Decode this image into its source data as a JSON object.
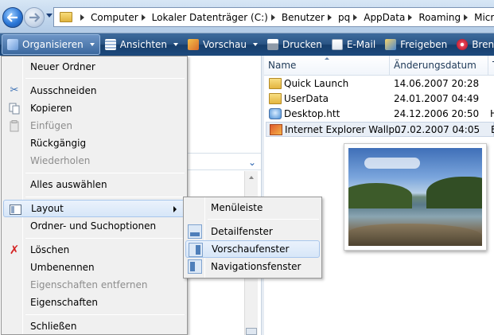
{
  "address": {
    "crumbs": [
      "Computer",
      "Lokaler Datenträger (C:)",
      "Benutzer",
      "pq",
      "AppData",
      "Roaming",
      "Microsoft"
    ]
  },
  "toolbar": {
    "organize": "Organisieren",
    "views": "Ansichten",
    "preview": "Vorschau",
    "print": "Drucken",
    "email": "E-Mail",
    "share": "Freigeben",
    "burn": "Brennen"
  },
  "columns": {
    "name": "Name",
    "date": "Änderungsdatum",
    "type": "T"
  },
  "files": [
    {
      "name": "Quick Launch",
      "date": "14.06.2007 20:28",
      "icon": "folder-icon",
      "tail": ""
    },
    {
      "name": "UserData",
      "date": "24.01.2007 04:49",
      "icon": "folder-icon",
      "tail": ""
    },
    {
      "name": "Desktop.htt",
      "date": "24.12.2006 20:50",
      "icon": "htt-file-icon",
      "tail": "H"
    },
    {
      "name": "Internet Explorer Wallp...",
      "date": "07.02.2007 04:05",
      "icon": "image-file-icon",
      "tail": "B"
    }
  ],
  "menu": {
    "new_folder": "Neuer Ordner",
    "cut": "Ausschneiden",
    "copy": "Kopieren",
    "paste": "Einfügen",
    "undo": "Rückgängig",
    "redo": "Wiederholen",
    "select_all": "Alles auswählen",
    "layout": "Layout",
    "folder_options": "Ordner- und Suchoptionen",
    "delete": "Löschen",
    "rename": "Umbenennen",
    "remove_props": "Eigenschaften entfernen",
    "properties": "Eigenschaften",
    "close": "Schließen"
  },
  "submenu": {
    "menubar": "Menüleiste",
    "details_pane": "Detailfenster",
    "preview_pane": "Vorschaufenster",
    "navigation_pane": "Navigationsfenster"
  }
}
